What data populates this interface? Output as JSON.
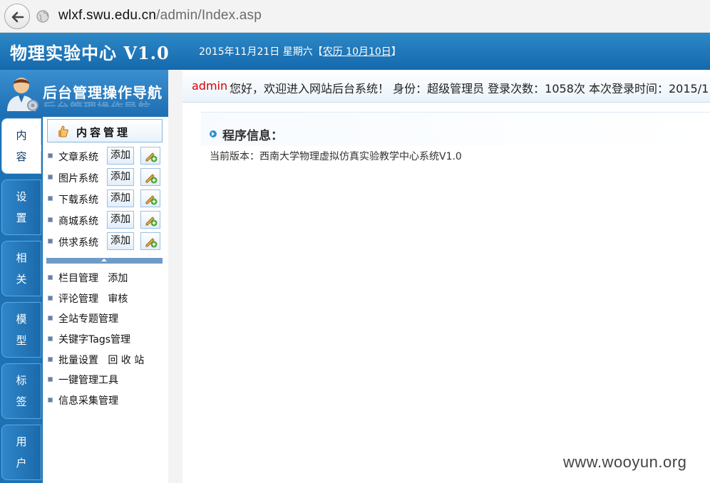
{
  "browser": {
    "url_domain": "wlxf.swu.edu.cn",
    "url_path": "/admin/Index.asp"
  },
  "banner": {
    "title": "物理实验中心 V1.0",
    "date": "2015年11月21日 星期六",
    "lunar_open": "【",
    "lunar": "农历 10月10日",
    "lunar_close": "】"
  },
  "nav_header": {
    "label": "后台管理操作导航"
  },
  "welcome": {
    "user": "admin",
    "message": "您好，欢迎进入网站后台系统！ 身份：超级管理员 登录次数：1058次 本次登录时间：2015/1"
  },
  "tabs": [
    {
      "c1": "内",
      "c2": "容"
    },
    {
      "c1": "设",
      "c2": "置"
    },
    {
      "c1": "相",
      "c2": "关"
    },
    {
      "c1": "模",
      "c2": "型"
    },
    {
      "c1": "标",
      "c2": "签"
    },
    {
      "c1": "用",
      "c2": "户"
    }
  ],
  "menu": {
    "header": "内容管理",
    "add_label": "添加",
    "systems": [
      "文章系统",
      "图片系统",
      "下载系统",
      "商城系统",
      "供求系统"
    ],
    "links": [
      "栏目管理   添加",
      "评论管理   审核",
      "全站专题管理",
      "关键字Tags管理",
      "批量设置   回 收 站",
      "一键管理工具",
      "信息采集管理"
    ]
  },
  "content": {
    "info_title": "程序信息：",
    "version": "当前版本：西南大学物理虚拟仿真实验教学中心系统V1.0"
  },
  "watermark": "www.wooyun.org",
  "colors": {
    "banner_blue": "#1d6eb2",
    "welcome_user": "#d40000"
  }
}
